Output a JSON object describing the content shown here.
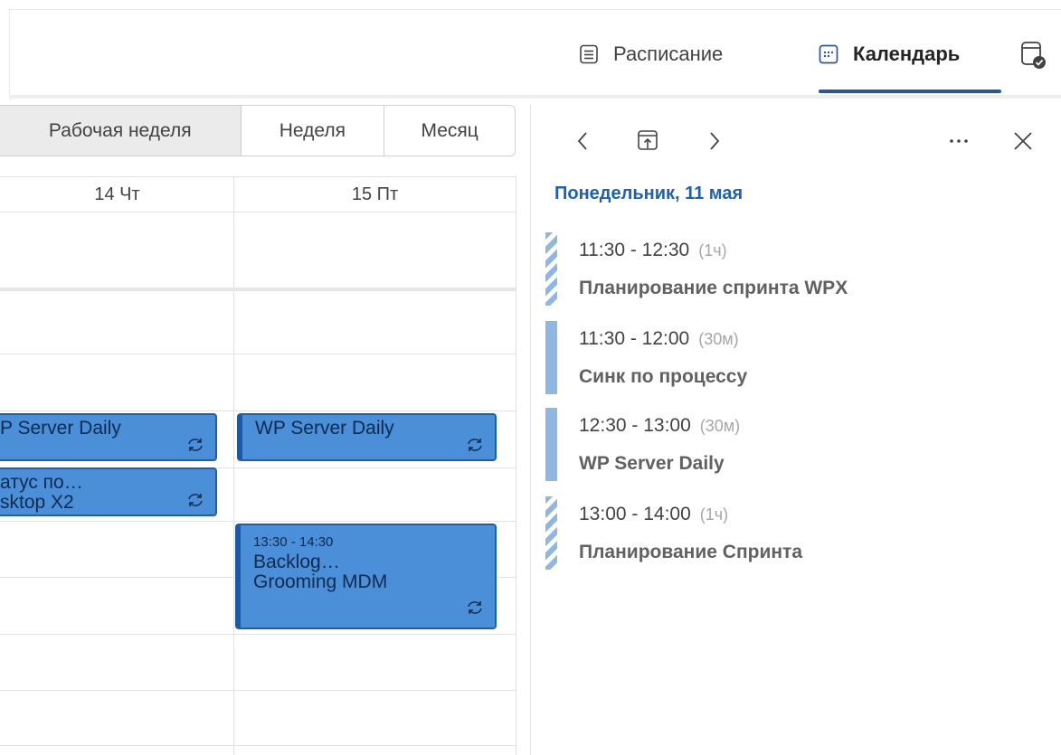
{
  "header": {
    "tabs": [
      {
        "label": "Расписание",
        "icon": "list-icon",
        "active": false
      },
      {
        "label": "Календарь",
        "icon": "calendar-grid-icon",
        "active": true
      }
    ],
    "extra_icon": "calendar-check-icon"
  },
  "calendar": {
    "views": [
      "Рабочая неделя",
      "Неделя",
      "Месяц"
    ],
    "selected_view": "Рабочая неделя",
    "days": [
      "14 Чт",
      "15 Пт"
    ],
    "events": [
      {
        "day": "14 Чт",
        "title": "P Server Daily",
        "recurring": true
      },
      {
        "day": "14 Чт",
        "title": "атус по…\nsktop X2",
        "recurring": true
      },
      {
        "day": "15 Пт",
        "title": "WP Server Daily",
        "recurring": true
      },
      {
        "day": "15 Пт",
        "time": "13:30 - 14:30",
        "title": "Backlog…\nGrooming MDM",
        "recurring": true
      }
    ]
  },
  "day_pane": {
    "title": "Понедельник, 11 мая",
    "nav": {
      "prev_icon": "chevron-left-icon",
      "today_icon": "go-to-today-icon",
      "next_icon": "chevron-right-icon",
      "more_icon": "more-icon",
      "close_icon": "close-icon"
    },
    "items": [
      {
        "time": "11:30 - 12:30",
        "duration": "(1ч)",
        "title": "Планирование спринта WPX",
        "bar": "striped"
      },
      {
        "time": "11:30 - 12:00",
        "duration": "(30м)",
        "title": "Синк по процессу",
        "bar": "solid"
      },
      {
        "time": "12:30 - 13:00",
        "duration": "(30м)",
        "title": "WP Server Daily",
        "bar": "solid"
      },
      {
        "time": "13:00 - 14:00",
        "duration": "(1ч)",
        "title": "Планирование Спринта",
        "bar": "striped"
      }
    ]
  },
  "colors": {
    "accent": "#1a62b0",
    "event_fill": "#4a8fd8",
    "event_border": "#1a59a6",
    "agenda_bar": "#8fb7e3"
  }
}
